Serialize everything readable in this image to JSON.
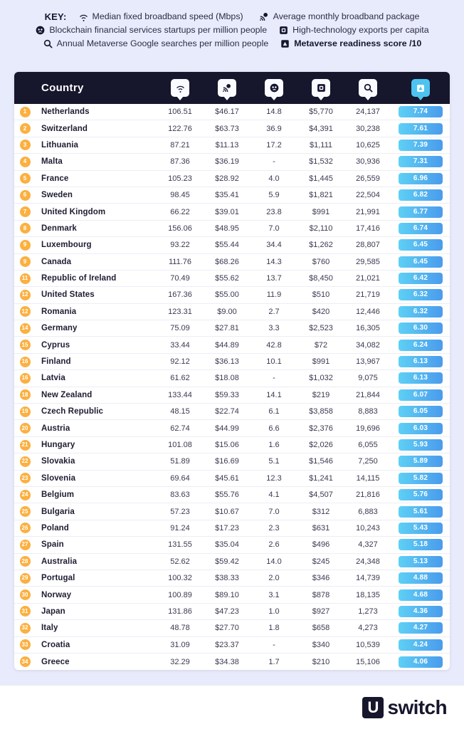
{
  "key": {
    "label": "KEY:",
    "items": [
      {
        "icon": "wifi-icon",
        "text": "Median fixed broadband speed (Mbps)",
        "bold": false,
        "row": 1
      },
      {
        "icon": "router-icon",
        "text": "Average monthly broadband package",
        "bold": false,
        "row": 1
      },
      {
        "icon": "blockchain-icon",
        "text": "Blockchain financial services startups per million people",
        "bold": false,
        "row": 2
      },
      {
        "icon": "chip-icon",
        "text": "High-technology exports per capita",
        "bold": false,
        "row": 2
      },
      {
        "icon": "search-icon",
        "text": "Annual Metaverse Google searches per million people",
        "bold": false,
        "row": 3
      },
      {
        "icon": "vr-icon",
        "text": "Metaverse readiness score /10",
        "bold": true,
        "row": 3
      }
    ]
  },
  "table": {
    "headers": {
      "rank": "",
      "country": "Country",
      "columns": [
        {
          "icon": "wifi-icon",
          "accent": false
        },
        {
          "icon": "router-icon",
          "accent": false
        },
        {
          "icon": "blockchain-icon",
          "accent": false
        },
        {
          "icon": "chip-icon",
          "accent": false
        },
        {
          "icon": "search-icon",
          "accent": false
        },
        {
          "icon": "vr-icon",
          "accent": true
        }
      ]
    },
    "rows": [
      {
        "rank": "1",
        "country": "Netherlands",
        "speed": "106.51",
        "price": "$46.17",
        "startups": "14.8",
        "exports": "$5,770",
        "searches": "24,137",
        "score": "7.74"
      },
      {
        "rank": "2",
        "country": "Switzerland",
        "speed": "122.76",
        "price": "$63.73",
        "startups": "36.9",
        "exports": "$4,391",
        "searches": "30,238",
        "score": "7.61"
      },
      {
        "rank": "3",
        "country": "Lithuania",
        "speed": "87.21",
        "price": "$11.13",
        "startups": "17.2",
        "exports": "$1,111",
        "searches": "10,625",
        "score": "7.39"
      },
      {
        "rank": "4",
        "country": "Malta",
        "speed": "87.36",
        "price": "$36.19",
        "startups": "-",
        "exports": "$1,532",
        "searches": "30,936",
        "score": "7.31"
      },
      {
        "rank": "5",
        "country": "France",
        "speed": "105.23",
        "price": "$28.92",
        "startups": "4.0",
        "exports": "$1,445",
        "searches": "26,559",
        "score": "6.96"
      },
      {
        "rank": "6",
        "country": "Sweden",
        "speed": "98.45",
        "price": "$35.41",
        "startups": "5.9",
        "exports": "$1,821",
        "searches": "22,504",
        "score": "6.82"
      },
      {
        "rank": "7",
        "country": "United Kingdom",
        "speed": "66.22",
        "price": "$39.01",
        "startups": "23.8",
        "exports": "$991",
        "searches": "21,991",
        "score": "6.77"
      },
      {
        "rank": "8",
        "country": "Denmark",
        "speed": "156.06",
        "price": "$48.95",
        "startups": "7.0",
        "exports": "$2,110",
        "searches": "17,416",
        "score": "6.74"
      },
      {
        "rank": "9",
        "country": "Luxembourg",
        "speed": "93.22",
        "price": "$55.44",
        "startups": "34.4",
        "exports": "$1,262",
        "searches": "28,807",
        "score": "6.45"
      },
      {
        "rank": "9",
        "country": "Canada",
        "speed": "111.76",
        "price": "$68.26",
        "startups": "14.3",
        "exports": "$760",
        "searches": "29,585",
        "score": "6.45"
      },
      {
        "rank": "11",
        "country": "Republic of Ireland",
        "speed": "70.49",
        "price": "$55.62",
        "startups": "13.7",
        "exports": "$8,450",
        "searches": "21,021",
        "score": "6.42"
      },
      {
        "rank": "12",
        "country": "United States",
        "speed": "167.36",
        "price": "$55.00",
        "startups": "11.9",
        "exports": "$510",
        "searches": "21,719",
        "score": "6.32"
      },
      {
        "rank": "12",
        "country": "Romania",
        "speed": "123.31",
        "price": "$9.00",
        "startups": "2.7",
        "exports": "$420",
        "searches": "12,446",
        "score": "6.32"
      },
      {
        "rank": "14",
        "country": "Germany",
        "speed": "75.09",
        "price": "$27.81",
        "startups": "3.3",
        "exports": "$2,523",
        "searches": "16,305",
        "score": "6.30"
      },
      {
        "rank": "15",
        "country": "Cyprus",
        "speed": "33.44",
        "price": "$44.89",
        "startups": "42.8",
        "exports": "$72",
        "searches": "34,082",
        "score": "6.24"
      },
      {
        "rank": "16",
        "country": "Finland",
        "speed": "92.12",
        "price": "$36.13",
        "startups": "10.1",
        "exports": "$991",
        "searches": "13,967",
        "score": "6.13"
      },
      {
        "rank": "16",
        "country": "Latvia",
        "speed": "61.62",
        "price": "$18.08",
        "startups": "-",
        "exports": "$1,032",
        "searches": "9,075",
        "score": "6.13"
      },
      {
        "rank": "18",
        "country": "New Zealand",
        "speed": "133.44",
        "price": "$59.33",
        "startups": "14.1",
        "exports": "$219",
        "searches": "21,844",
        "score": "6.07"
      },
      {
        "rank": "19",
        "country": "Czech Republic",
        "speed": "48.15",
        "price": "$22.74",
        "startups": "6.1",
        "exports": "$3,858",
        "searches": "8,883",
        "score": "6.05"
      },
      {
        "rank": "20",
        "country": "Austria",
        "speed": "62.74",
        "price": "$44.99",
        "startups": "6.6",
        "exports": "$2,376",
        "searches": "19,696",
        "score": "6.03"
      },
      {
        "rank": "21",
        "country": "Hungary",
        "speed": "101.08",
        "price": "$15.06",
        "startups": "1.6",
        "exports": "$2,026",
        "searches": "6,055",
        "score": "5.93"
      },
      {
        "rank": "22",
        "country": "Slovakia",
        "speed": "51.89",
        "price": "$16.69",
        "startups": "5.1",
        "exports": "$1,546",
        "searches": "7,250",
        "score": "5.89"
      },
      {
        "rank": "23",
        "country": "Slovenia",
        "speed": "69.64",
        "price": "$45.61",
        "startups": "12.3",
        "exports": "$1,241",
        "searches": "14,115",
        "score": "5.82"
      },
      {
        "rank": "24",
        "country": "Belgium",
        "speed": "83.63",
        "price": "$55.76",
        "startups": "4.1",
        "exports": "$4,507",
        "searches": "21,816",
        "score": "5.76"
      },
      {
        "rank": "25",
        "country": "Bulgaria",
        "speed": "57.23",
        "price": "$10.67",
        "startups": "7.0",
        "exports": "$312",
        "searches": "6,883",
        "score": "5.61"
      },
      {
        "rank": "26",
        "country": "Poland",
        "speed": "91.24",
        "price": "$17.23",
        "startups": "2.3",
        "exports": "$631",
        "searches": "10,243",
        "score": "5.43"
      },
      {
        "rank": "27",
        "country": "Spain",
        "speed": "131.55",
        "price": "$35.04",
        "startups": "2.6",
        "exports": "$496",
        "searches": "4,327",
        "score": "5.18"
      },
      {
        "rank": "28",
        "country": "Australia",
        "speed": "52.62",
        "price": "$59.42",
        "startups": "14.0",
        "exports": "$245",
        "searches": "24,348",
        "score": "5.13"
      },
      {
        "rank": "29",
        "country": "Portugal",
        "speed": "100.32",
        "price": "$38.33",
        "startups": "2.0",
        "exports": "$346",
        "searches": "14,739",
        "score": "4.88"
      },
      {
        "rank": "30",
        "country": "Norway",
        "speed": "100.89",
        "price": "$89.10",
        "startups": "3.1",
        "exports": "$878",
        "searches": "18,135",
        "score": "4.68"
      },
      {
        "rank": "31",
        "country": "Japan",
        "speed": "131.86",
        "price": "$47.23",
        "startups": "1.0",
        "exports": "$927",
        "searches": "1,273",
        "score": "4.36"
      },
      {
        "rank": "32",
        "country": "Italy",
        "speed": "48.78",
        "price": "$27.70",
        "startups": "1.8",
        "exports": "$658",
        "searches": "4,273",
        "score": "4.27"
      },
      {
        "rank": "33",
        "country": "Croatia",
        "speed": "31.09",
        "price": "$23.37",
        "startups": "-",
        "exports": "$340",
        "searches": "10,539",
        "score": "4.24"
      },
      {
        "rank": "34",
        "country": "Greece",
        "speed": "32.29",
        "price": "$34.38",
        "startups": "1.7",
        "exports": "$210",
        "searches": "15,106",
        "score": "4.06"
      }
    ]
  },
  "footer": {
    "logo_mark": "U",
    "logo_word": "switch"
  },
  "colors": {
    "background": "#e8ebfb",
    "header_bar": "#16162c",
    "rank_badge": "#fbb040",
    "score_gradient_start": "#5ed0f5",
    "score_gradient_end": "#4a9bec",
    "accent_pin": "#4ec3f0"
  }
}
